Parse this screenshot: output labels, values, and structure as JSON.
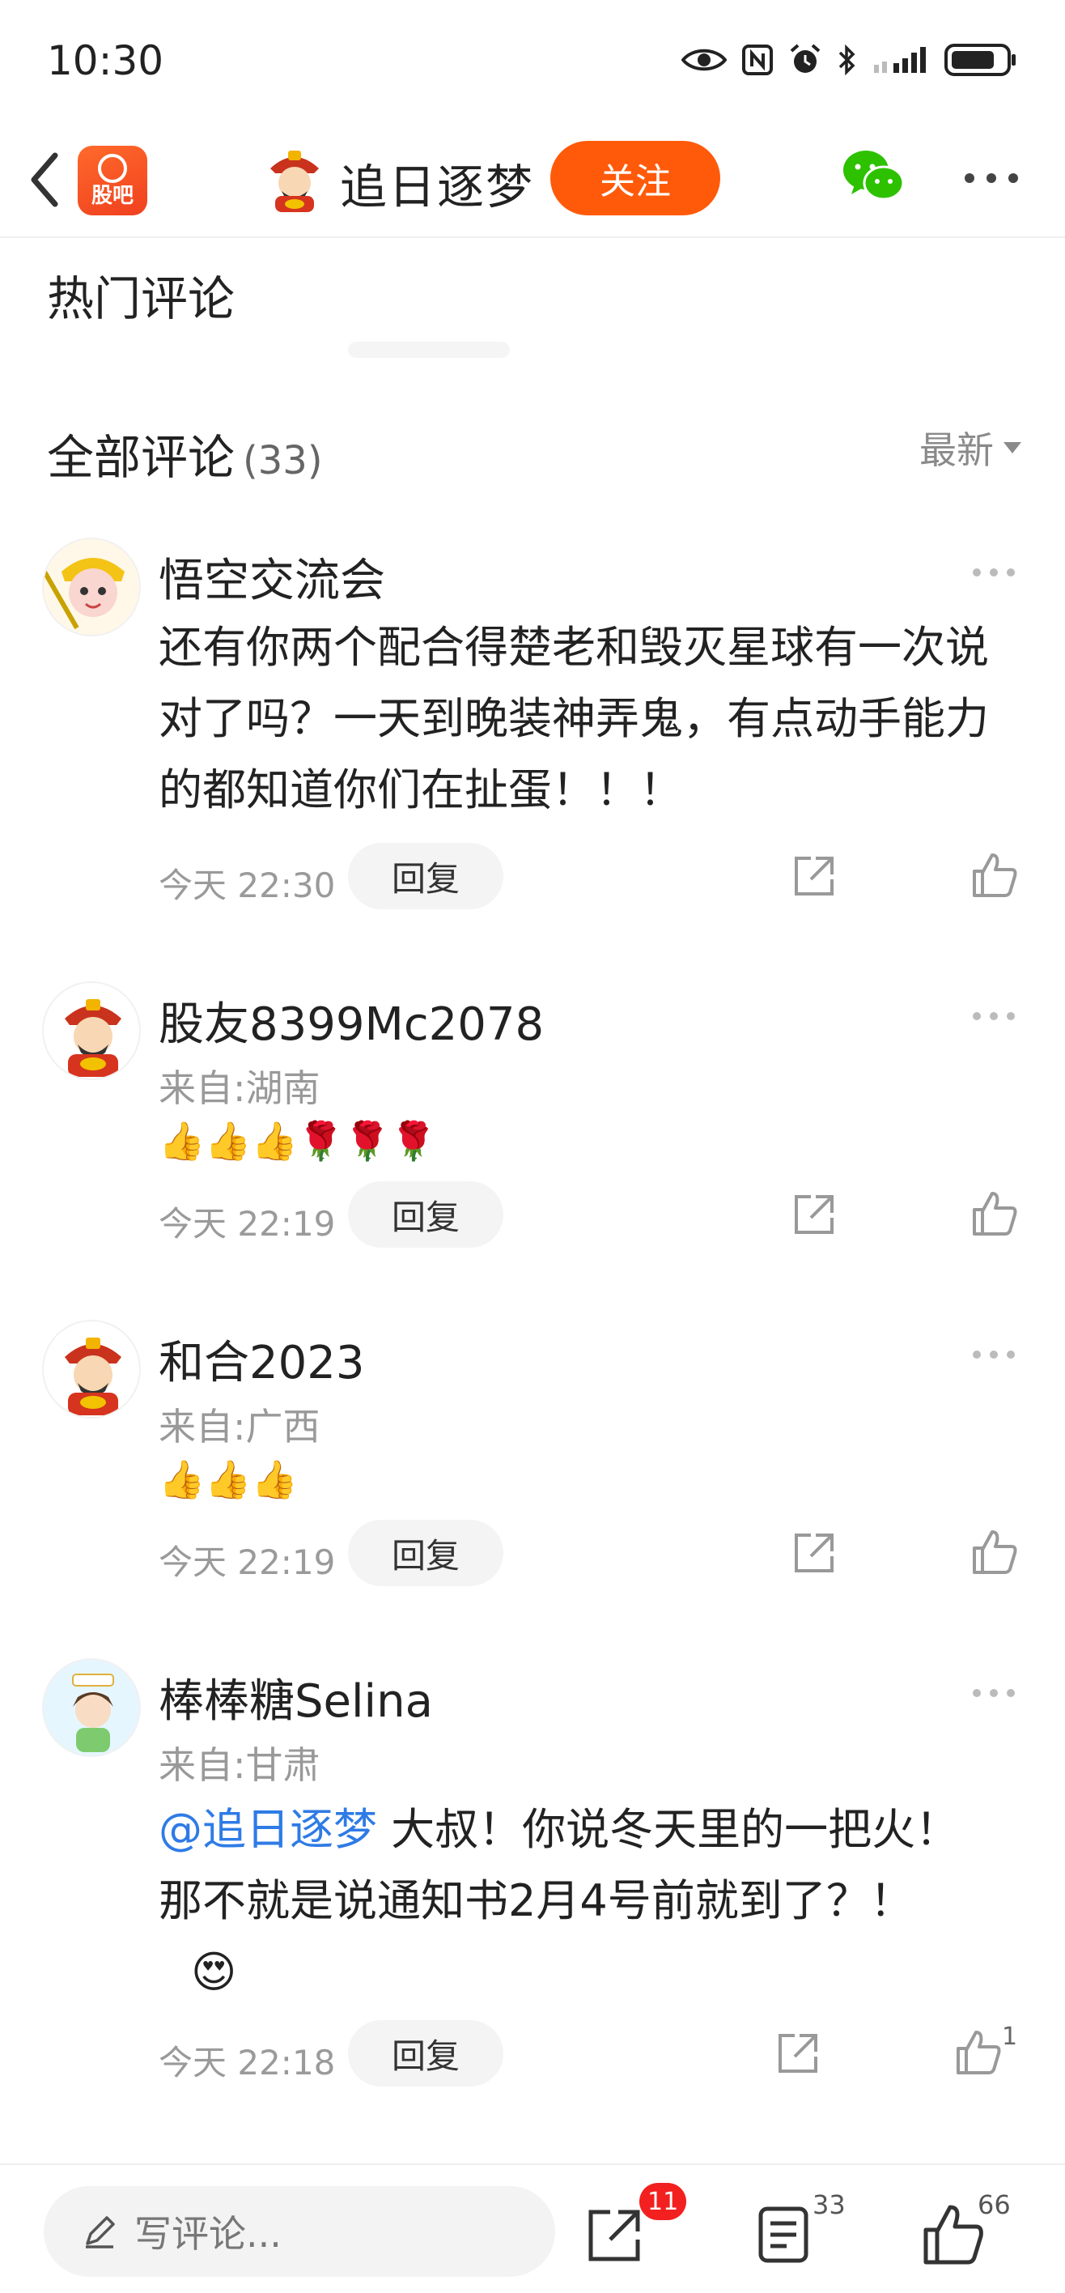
{
  "status_bar": {
    "time": "10:30"
  },
  "nav": {
    "logo_text": "股吧",
    "author_name": "追日逐梦",
    "follow_label": "关注"
  },
  "sections": {
    "hot_title": "热门评论",
    "all_title": "全部评论",
    "all_count": "(33)",
    "sort_label": "最新"
  },
  "comments": [
    {
      "name": "悟空交流会",
      "from": "",
      "text": "还有你两个配合得楚老和毁灭星球有一次说对了吗？一天到晚装神弄鬼，有点动手能力的都知道你们在扯蛋！！！",
      "time": "今天 22:30",
      "reply_label": "回复",
      "likes": ""
    },
    {
      "name": "股友8399Mc2078",
      "from": "来自:湖南",
      "emojis": "👍👍👍🌹🌹🌹",
      "time": "今天 22:19",
      "reply_label": "回复",
      "likes": ""
    },
    {
      "name": "和合2023",
      "from": "来自:广西",
      "emojis": "👍👍👍",
      "time": "今天 22:19",
      "reply_label": "回复",
      "likes": ""
    },
    {
      "name": "棒棒糖Selina",
      "from": "来自:甘肃",
      "mention": "@追日逐梦",
      "text": " 大叔！你说冬天里的一把火！那不就是说通知书2月4号前就到了？！",
      "emoji": "😍",
      "time": "今天 22:18",
      "reply_label": "回复",
      "likes": "1"
    }
  ],
  "bottom_bar": {
    "input_placeholder": "写评论...",
    "share_badge": "11",
    "comment_count": "33",
    "like_count": "66"
  },
  "colors": {
    "accent": "#ff5a0a",
    "mention": "#2e7be6",
    "badge": "#f2201f"
  }
}
